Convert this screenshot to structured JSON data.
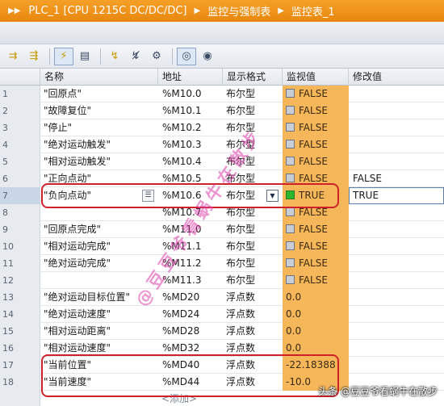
{
  "breadcrumb": {
    "device": "PLC_1 [CPU 1215C DC/DC/DC]",
    "folder": "监控与强制表",
    "table": "监控表_1"
  },
  "toolbar": {
    "icons": [
      "insert-row-icon",
      "add-row-icon",
      "modify-now-icon",
      "modify-trigger-icon",
      "force-icon",
      "monitor-all-icon",
      "monitor-once-icon"
    ]
  },
  "columns": {
    "num": "",
    "name": "名称",
    "address": "地址",
    "format": "显示格式",
    "monitor": "监视值",
    "modify": "修改值"
  },
  "rows": [
    {
      "num": "1",
      "name": "\"回原点\"",
      "address": "%M10.0",
      "format": "布尔型",
      "monitor": "FALSE",
      "modify": "",
      "bool": true,
      "on": false
    },
    {
      "num": "2",
      "name": "\"故障复位\"",
      "address": "%M10.1",
      "format": "布尔型",
      "monitor": "FALSE",
      "modify": "",
      "bool": true,
      "on": false
    },
    {
      "num": "3",
      "name": "\"停止\"",
      "address": "%M10.2",
      "format": "布尔型",
      "monitor": "FALSE",
      "modify": "",
      "bool": true,
      "on": false
    },
    {
      "num": "4",
      "name": "\"绝对运动触发\"",
      "address": "%M10.3",
      "format": "布尔型",
      "monitor": "FALSE",
      "modify": "",
      "bool": true,
      "on": false
    },
    {
      "num": "5",
      "name": "\"相对运动触发\"",
      "address": "%M10.4",
      "format": "布尔型",
      "monitor": "FALSE",
      "modify": "",
      "bool": true,
      "on": false
    },
    {
      "num": "6",
      "name": "\"正向点动\"",
      "address": "%M10.5",
      "format": "布尔型",
      "monitor": "FALSE",
      "modify": "FALSE",
      "bool": true,
      "on": false
    },
    {
      "num": "7",
      "name": "\"负向点动\"",
      "address": "%M10.6",
      "format": "布尔型",
      "monitor": "TRUE",
      "modify": "TRUE",
      "bool": true,
      "on": true
    },
    {
      "num": "8",
      "name": "",
      "address": "%M10.7",
      "format": "布尔型",
      "monitor": "FALSE",
      "modify": "",
      "bool": true,
      "on": false
    },
    {
      "num": "9",
      "name": "\"回原点完成\"",
      "address": "%M11.0",
      "format": "布尔型",
      "monitor": "FALSE",
      "modify": "",
      "bool": true,
      "on": false
    },
    {
      "num": "10",
      "name": "\"相对运动完成\"",
      "address": "%M11.1",
      "format": "布尔型",
      "monitor": "FALSE",
      "modify": "",
      "bool": true,
      "on": false
    },
    {
      "num": "11",
      "name": "\"绝对运动完成\"",
      "address": "%M11.2",
      "format": "布尔型",
      "monitor": "FALSE",
      "modify": "",
      "bool": true,
      "on": false
    },
    {
      "num": "12",
      "name": "",
      "address": "%M11.3",
      "format": "布尔型",
      "monitor": "FALSE",
      "modify": "",
      "bool": true,
      "on": false
    },
    {
      "num": "13",
      "name": "\"绝对运动目标位置\"",
      "address": "%MD20",
      "format": "浮点数",
      "monitor": "0.0",
      "modify": "",
      "bool": false,
      "on": false
    },
    {
      "num": "14",
      "name": "\"绝对运动速度\"",
      "address": "%MD24",
      "format": "浮点数",
      "monitor": "0.0",
      "modify": "",
      "bool": false,
      "on": false
    },
    {
      "num": "15",
      "name": "\"相对运动距离\"",
      "address": "%MD28",
      "format": "浮点数",
      "monitor": "0.0",
      "modify": "",
      "bool": false,
      "on": false
    },
    {
      "num": "16",
      "name": "\"相对运动速度\"",
      "address": "%MD32",
      "format": "浮点数",
      "monitor": "0.0",
      "modify": "",
      "bool": false,
      "on": false
    },
    {
      "num": "17",
      "name": "\"当前位置\"",
      "address": "%MD40",
      "format": "浮点数",
      "monitor": "-22.18388",
      "modify": "",
      "bool": false,
      "on": false
    },
    {
      "num": "18",
      "name": "\"当前速度\"",
      "address": "%MD44",
      "format": "浮点数",
      "monitor": "-10.0",
      "modify": "",
      "bool": false,
      "on": false
    }
  ],
  "add_row": {
    "label": "<添加>"
  },
  "watermark": "@豆豆爷看蜗牛在散步",
  "footer": "头条 @豆豆爷看蜗牛在散步",
  "colors": {
    "title_bar": "#e8870f",
    "monitor_column": "#f5b75a",
    "highlight": "#d0212a",
    "true_indicator": "#2fb52d"
  }
}
